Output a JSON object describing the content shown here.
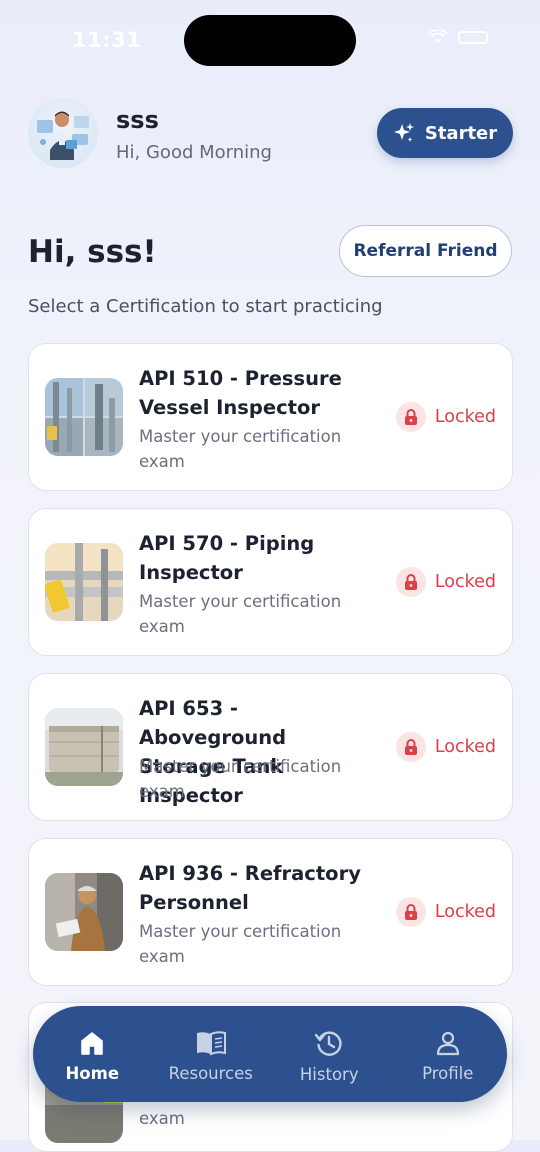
{
  "status": {
    "time": "11:31"
  },
  "header": {
    "username": "sss",
    "greeting": "Hi, Good Morning",
    "starter_label": "Starter"
  },
  "main": {
    "hi_title": "Hi, sss!",
    "referral_label": "Referral Friend",
    "subtitle": "Select a Certification to start practicing"
  },
  "certifications": [
    {
      "title_line1": "API 510 - Pressure",
      "title_line2": "Vessel Inspector",
      "sub_line1": "Master your certification",
      "sub_line2": "exam",
      "status": "Locked"
    },
    {
      "title_line1": "API 570 - Piping",
      "title_line2": "Inspector",
      "sub_line1": "Master your certification",
      "sub_line2": "exam",
      "status": "Locked"
    },
    {
      "title_line1": "API 653 - Aboveground",
      "title_line2": "Storage Tank Inspector",
      "sub_line1": "Master your certification",
      "sub_line2": "exam",
      "status": "Locked"
    },
    {
      "title_line1": "API 936 - Refractory",
      "title_line2": "Personnel",
      "sub_line1": "Master your certification",
      "sub_line2": "exam",
      "status": "Locked"
    }
  ],
  "partial_card": {
    "sub_line2": "exam"
  },
  "nav": [
    {
      "label": "Home",
      "icon": "home-icon",
      "active": true
    },
    {
      "label": "Resources",
      "icon": "book-icon",
      "active": false
    },
    {
      "label": "History",
      "icon": "history-icon",
      "active": false
    },
    {
      "label": "Profile",
      "icon": "user-icon",
      "active": false
    }
  ],
  "colors": {
    "primary": "#2d518e",
    "locked": "#d9404a",
    "lock_bg": "#fbe4e4"
  }
}
